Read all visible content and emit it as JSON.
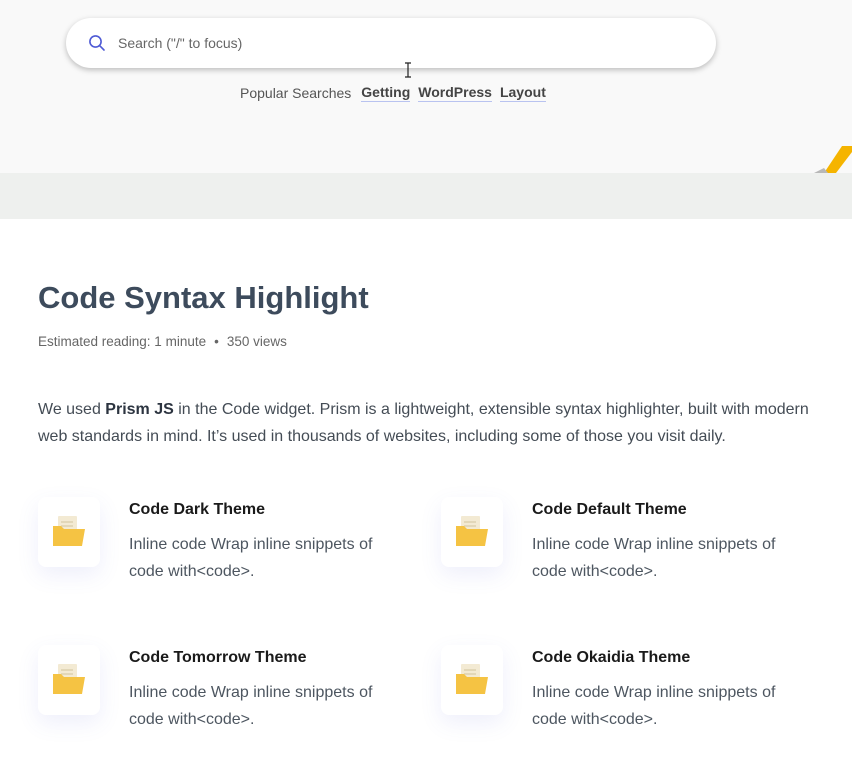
{
  "search": {
    "placeholder": "Search (\"/\" to focus)"
  },
  "popular": {
    "label": "Popular Searches",
    "links": [
      "Getting",
      "WordPress",
      "Layout"
    ]
  },
  "article": {
    "title": "Code Syntax Highlight",
    "reading": "Estimated reading: 1 minute",
    "separator": "•",
    "views": "350 views",
    "intro_before": "We used ",
    "intro_bold": "Prism JS",
    "intro_after": " in the Code widget. Prism is a lightweight, extensible syntax highlighter, built with modern web standards in mind. It’s used in thousands of websites, including some of those you visit daily."
  },
  "cards": [
    {
      "title": "Code Dark Theme",
      "desc": "Inline code Wrap inline snippets of code with<code>."
    },
    {
      "title": "Code Default Theme",
      "desc": "Inline code Wrap inline snippets of code with<code>."
    },
    {
      "title": "Code Tomorrow Theme",
      "desc": "Inline code Wrap inline snippets of code with<code>."
    },
    {
      "title": "Code Okaidia Theme",
      "desc": "Inline code Wrap inline snippets of code with<code>."
    }
  ],
  "icons": {
    "search": "search-icon",
    "card": "folder-document-icon",
    "cursor": "text-cursor-icon"
  },
  "colors": {
    "accent": "#4f5bd5",
    "title": "#3d4b5c",
    "folder": "#f5c343",
    "deco": "#f5b400"
  }
}
